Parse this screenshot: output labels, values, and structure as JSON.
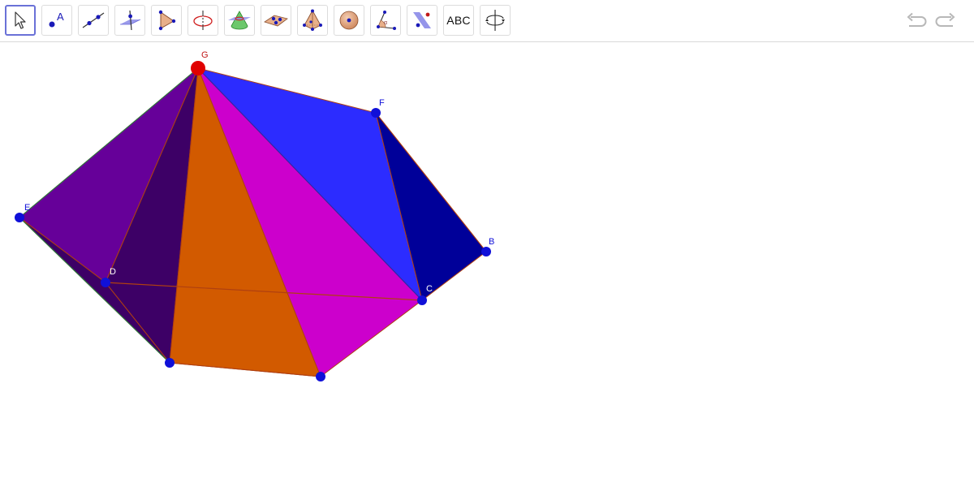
{
  "toolbar": {
    "tools": [
      {
        "name": "move-tool",
        "icon": "arrow-pointer-icon"
      },
      {
        "name": "point-tool",
        "icon": "point-with-label-icon",
        "label": "A"
      },
      {
        "name": "line-tool",
        "icon": "line-through-two-points-icon"
      },
      {
        "name": "perpendicular-line-tool",
        "icon": "perpendicular-line-icon"
      },
      {
        "name": "polygon-tool",
        "icon": "triangle-icon"
      },
      {
        "name": "circle-tool",
        "icon": "circle-around-axis-icon"
      },
      {
        "name": "intersect-tool",
        "icon": "cone-icon"
      },
      {
        "name": "plane-tool",
        "icon": "plane-through-points-icon"
      },
      {
        "name": "pyramid-tool",
        "icon": "pyramid-icon"
      },
      {
        "name": "sphere-tool",
        "icon": "sphere-icon"
      },
      {
        "name": "angle-tool",
        "icon": "angle-icon"
      },
      {
        "name": "reflect-tool",
        "icon": "reflect-about-plane-icon"
      },
      {
        "name": "text-tool",
        "icon": "text-icon",
        "label": "ABC"
      },
      {
        "name": "rotate-view-tool",
        "icon": "rotate-view-icon"
      }
    ],
    "undo_icon": "undo-icon",
    "redo_icon": "redo-icon"
  },
  "graphics": {
    "points": [
      {
        "name": "G",
        "label": "G",
        "color": "#e00000"
      },
      {
        "name": "F",
        "label": "F",
        "color": "#1010d8"
      },
      {
        "name": "E",
        "label": "E",
        "color": "#1010d8"
      },
      {
        "name": "D",
        "label": "D",
        "color": "#1010d8"
      },
      {
        "name": "C",
        "label": "C",
        "color": "#1010d8"
      },
      {
        "name": "B",
        "label": "B",
        "color": "#1010d8"
      }
    ],
    "face_colors": {
      "purple": "#660099",
      "dark_purple": "#3d0066",
      "orange": "#d25a00",
      "magenta": "#cc00cc",
      "blue": "#2c2cff",
      "navy": "#000099"
    },
    "edge_color": "#b04010",
    "accent_color": "#6a71d7"
  }
}
